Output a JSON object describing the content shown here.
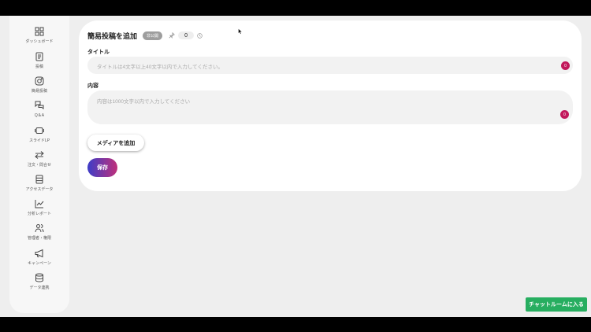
{
  "sidebar": {
    "items": [
      {
        "label": "ダッシュボード",
        "icon": "dashboard-grid-icon"
      },
      {
        "label": "投稿",
        "icon": "post-document-icon"
      },
      {
        "label": "簡易投稿",
        "icon": "instagram-icon"
      },
      {
        "label": "Q＆A",
        "icon": "chat-bubbles-icon"
      },
      {
        "label": "スライドLP",
        "icon": "slides-icon"
      },
      {
        "label": "注文・問合せ",
        "icon": "exchange-arrows-icon"
      },
      {
        "label": "アクセスデータ",
        "icon": "list-rows-icon"
      },
      {
        "label": "分析レポート",
        "icon": "chart-icon"
      },
      {
        "label": "管理者・権限",
        "icon": "users-icon"
      },
      {
        "label": "キャンペーン",
        "icon": "megaphone-icon"
      },
      {
        "label": "データ連携",
        "icon": "database-icon"
      }
    ]
  },
  "form": {
    "title": "簡易投稿を追加",
    "status_badge": "非公開",
    "pin_count": "0",
    "title_field": {
      "label": "タイトル",
      "placeholder": "タイトルは4文字以上40文字以内で入力してください。",
      "counter": "0"
    },
    "content_field": {
      "label": "内容",
      "placeholder": "内容は1000文字以内で入力してください",
      "counter": "0"
    },
    "media_button": "メディアを追加",
    "save_button": "保存"
  },
  "chat_button": "チャットルームに入る",
  "colors": {
    "accent_counter": "#c2185b",
    "save_gradient_start": "#3d3dc8",
    "save_gradient_end": "#c0307a",
    "chat_button": "#27ae60",
    "badge": "#9e9e9e"
  }
}
